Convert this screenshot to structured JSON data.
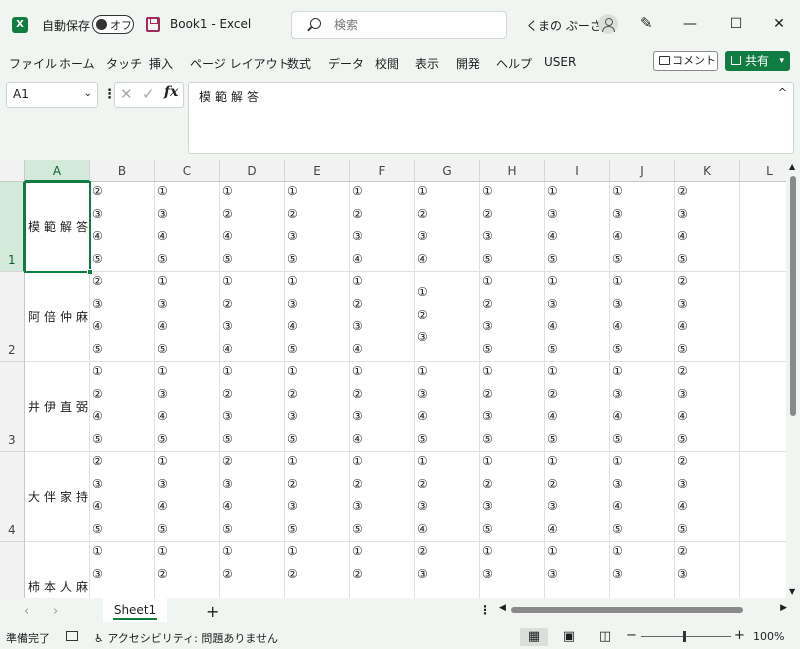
{
  "titlebar": {
    "app_icon": "excel-icon",
    "autosave_label": "自動保存",
    "autosave_toggle": "オフ",
    "doc_title": "Book1  -  Excel",
    "search_placeholder": "検索",
    "user_name": "くまの ぷーさん",
    "minimize": "—",
    "maximize": "☐",
    "close": "✕"
  },
  "menu": [
    "ファイル",
    "ホーム",
    "タッチ",
    "挿入",
    "ページ レイアウト",
    "数式",
    "データ",
    "校閲",
    "表示",
    "開発",
    "ヘルプ",
    "USER"
  ],
  "comment_button": "コメント",
  "share_button": "共有",
  "formula_bar": {
    "name_box": "A1",
    "formula": "模範解答",
    "fx": "fx",
    "cancel": "✕",
    "enter": "✓"
  },
  "columns": [
    "A",
    "B",
    "C",
    "D",
    "E",
    "F",
    "G",
    "H",
    "I",
    "J",
    "K",
    "L"
  ],
  "rows": [
    {
      "num": "1",
      "name": "模範解答",
      "answers": [
        [
          "②",
          "③",
          "④",
          "⑤"
        ],
        [
          "①",
          "③",
          "④",
          "⑤"
        ],
        [
          "①",
          "②",
          "④",
          "⑤"
        ],
        [
          "①",
          "②",
          "③",
          "⑤"
        ],
        [
          "①",
          "②",
          "③",
          "④"
        ],
        [
          "①",
          "②",
          "③",
          "④"
        ],
        [
          "①",
          "②",
          "③",
          "⑤"
        ],
        [
          "①",
          "③",
          "④",
          "⑤"
        ],
        [
          "①",
          "③",
          "④",
          "⑤"
        ],
        [
          "②",
          "③",
          "④",
          "⑤"
        ]
      ]
    },
    {
      "num": "2",
      "name": "阿倍仲麻呂",
      "answers": [
        [
          "②",
          "③",
          "④",
          "⑤"
        ],
        [
          "①",
          "③",
          "④",
          "⑤"
        ],
        [
          "①",
          "②",
          "③",
          "④"
        ],
        [
          "①",
          "③",
          "④",
          "⑤"
        ],
        [
          "①",
          "②",
          "③",
          "④"
        ],
        [
          "①",
          "②",
          "③"
        ],
        [
          "①",
          "②",
          "③",
          "⑤"
        ],
        [
          "①",
          "③",
          "④",
          "⑤"
        ],
        [
          "①",
          "③",
          "④",
          "⑤"
        ],
        [
          "②",
          "③",
          "④",
          "⑤"
        ]
      ]
    },
    {
      "num": "3",
      "name": "井伊直弼",
      "answers": [
        [
          "①",
          "②",
          "④",
          "⑤"
        ],
        [
          "①",
          "③",
          "④",
          "⑤"
        ],
        [
          "①",
          "②",
          "③",
          "⑤"
        ],
        [
          "①",
          "②",
          "③",
          "⑤"
        ],
        [
          "①",
          "②",
          "③",
          "④"
        ],
        [
          "①",
          "③",
          "④",
          "⑤"
        ],
        [
          "①",
          "②",
          "③",
          "⑤"
        ],
        [
          "①",
          "②",
          "④",
          "⑤"
        ],
        [
          "①",
          "③",
          "④",
          "⑤"
        ],
        [
          "②",
          "③",
          "④",
          "⑤"
        ]
      ]
    },
    {
      "num": "4",
      "name": "大伴家持",
      "answers": [
        [
          "②",
          "③",
          "④",
          "⑤"
        ],
        [
          "①",
          "③",
          "④",
          "⑤"
        ],
        [
          "②",
          "③",
          "④",
          "⑤"
        ],
        [
          "①",
          "②",
          "③",
          "⑤"
        ],
        [
          "①",
          "②",
          "③",
          "⑤"
        ],
        [
          "①",
          "②",
          "③",
          "④"
        ],
        [
          "①",
          "②",
          "③",
          "⑤"
        ],
        [
          "①",
          "②",
          "③",
          "④"
        ],
        [
          "①",
          "③",
          "④",
          "⑤"
        ],
        [
          "②",
          "③",
          "④",
          "⑤"
        ]
      ]
    },
    {
      "num": "5",
      "name": "柿本人麻呂",
      "answers": [
        [
          "①",
          "③"
        ],
        [
          "①",
          "②"
        ],
        [
          "①",
          "②"
        ],
        [
          "①",
          "②"
        ],
        [
          "①",
          "②"
        ],
        [
          "②",
          "③"
        ],
        [
          "①",
          "③"
        ],
        [
          "①",
          "③"
        ],
        [
          "①",
          "③"
        ],
        [
          "②",
          "③"
        ]
      ]
    }
  ],
  "sheet_tab": "Sheet1",
  "add_sheet": "+",
  "status": {
    "ready": "準備完了",
    "accessibility": "アクセシビリティ: 問題ありません",
    "zoom": "100%"
  },
  "colors": {
    "accent": "#107c41",
    "header_bg": "#f2f2f2",
    "selected_header_bg": "#d3e9da",
    "window_bg": "#f0f5f1"
  }
}
